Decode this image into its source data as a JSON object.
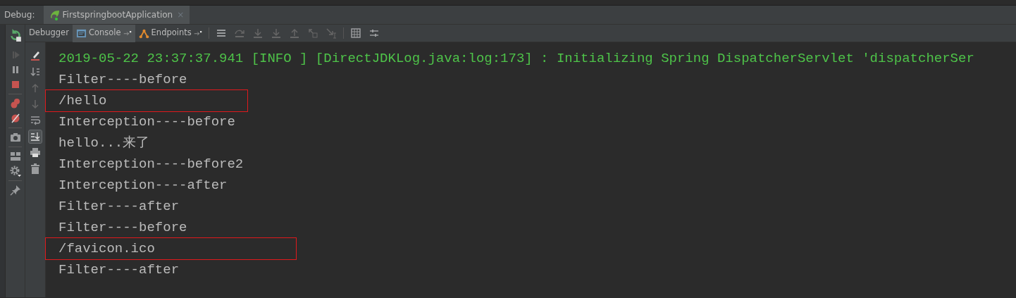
{
  "debug_label": "Debug:",
  "run_tab": {
    "title": "FirstspringbootApplication",
    "close": "×"
  },
  "tabs": [
    {
      "label": "Debugger",
      "selected": false,
      "kind": "plain"
    },
    {
      "label": "Console",
      "selected": true,
      "kind": "console"
    },
    {
      "label": "Endpoints",
      "selected": false,
      "kind": "endpoints"
    }
  ],
  "console_lines": [
    {
      "text": "2019-05-22 23:37:37.941 [INFO ] [DirectJDKLog.java:log:173] : Initializing Spring DispatcherServlet 'dispatcherSer",
      "kind": "log",
      "highlighted": false
    },
    {
      "text": "Filter----before",
      "kind": "out",
      "highlighted": false
    },
    {
      "text": "/hello",
      "kind": "out",
      "highlighted": true
    },
    {
      "text": "Interception----before",
      "kind": "out",
      "highlighted": false
    },
    {
      "text": "hello...来了",
      "kind": "out",
      "highlighted": false
    },
    {
      "text": "Interception----before2",
      "kind": "out",
      "highlighted": false
    },
    {
      "text": "Interception----after",
      "kind": "out",
      "highlighted": false
    },
    {
      "text": "Filter----after",
      "kind": "out",
      "highlighted": false
    },
    {
      "text": "Filter----before",
      "kind": "out",
      "highlighted": false
    },
    {
      "text": "/favicon.ico",
      "kind": "out",
      "highlighted": true
    },
    {
      "text": "Filter----after",
      "kind": "out",
      "highlighted": false
    }
  ]
}
